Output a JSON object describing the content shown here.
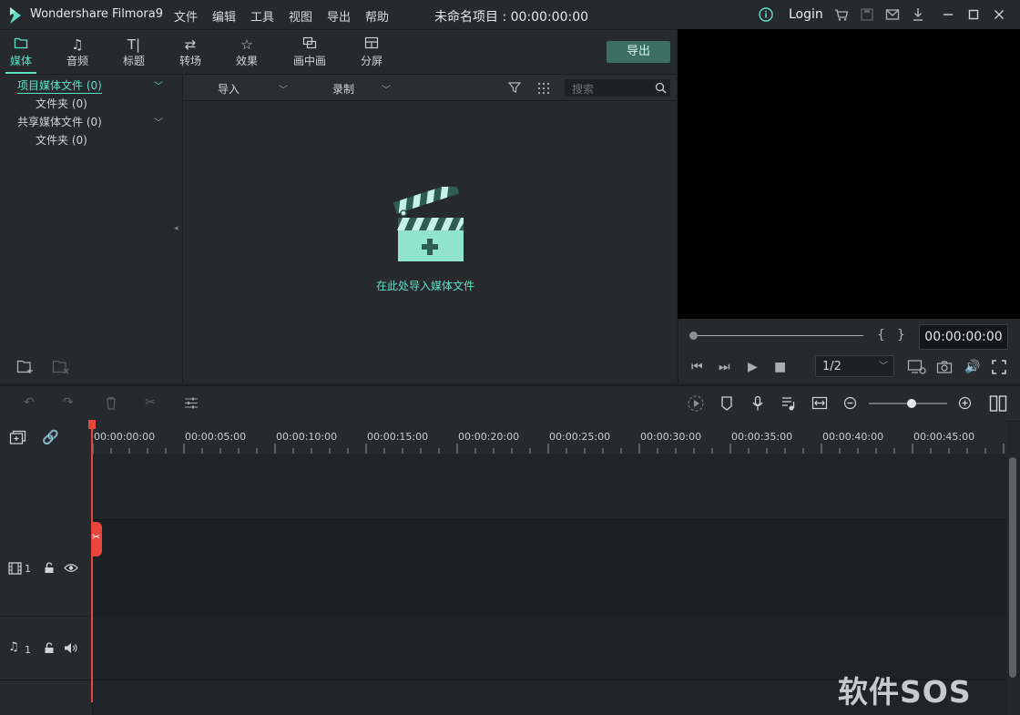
{
  "titlebar": {
    "app_name": "Wondershare Filmora9",
    "menus": [
      "文件",
      "编辑",
      "工具",
      "视图",
      "导出",
      "帮助"
    ],
    "project_title": "未命名项目 : 00:00:00:00",
    "login": "Login"
  },
  "tabs": [
    {
      "label": "媒体",
      "icon": "folder-icon"
    },
    {
      "label": "音频",
      "icon": "music-note-icon"
    },
    {
      "label": "标题",
      "icon": "title-icon"
    },
    {
      "label": "转场",
      "icon": "transition-icon"
    },
    {
      "label": "效果",
      "icon": "effects-icon"
    },
    {
      "label": "画中画",
      "icon": "pip-icon"
    },
    {
      "label": "分屏",
      "icon": "split-screen-icon"
    }
  ],
  "export_button": "导出",
  "sidebar": {
    "items": [
      {
        "label": "项目媒体文件 (0)"
      },
      {
        "label": "文件夹 (0)"
      },
      {
        "label": "共享媒体文件 (0)"
      },
      {
        "label": "文件夹 (0)"
      }
    ]
  },
  "media": {
    "import_label": "导入",
    "record_label": "录制",
    "search_placeholder": "搜索",
    "empty_text": "在此处导入媒体文件"
  },
  "preview": {
    "timecode": "00:00:00:00",
    "ratio": "1/2",
    "bracket_in": "{",
    "bracket_out": "}"
  },
  "timeline": {
    "ruler_labels": [
      "00:00:00:00",
      "00:00:05:00",
      "00:00:10:00",
      "00:00:15:00",
      "00:00:20:00",
      "00:00:25:00",
      "00:00:30:00",
      "00:00:35:00",
      "00:00:40:00",
      "00:00:45:00"
    ],
    "video_track_label": "1",
    "audio_track_label": "1",
    "zoom_level": 0.55
  },
  "watermark": "软件SOS",
  "colors": {
    "accent": "#5ee0c6",
    "playhead": "#e8453c",
    "export_bg": "#3c6e65"
  }
}
